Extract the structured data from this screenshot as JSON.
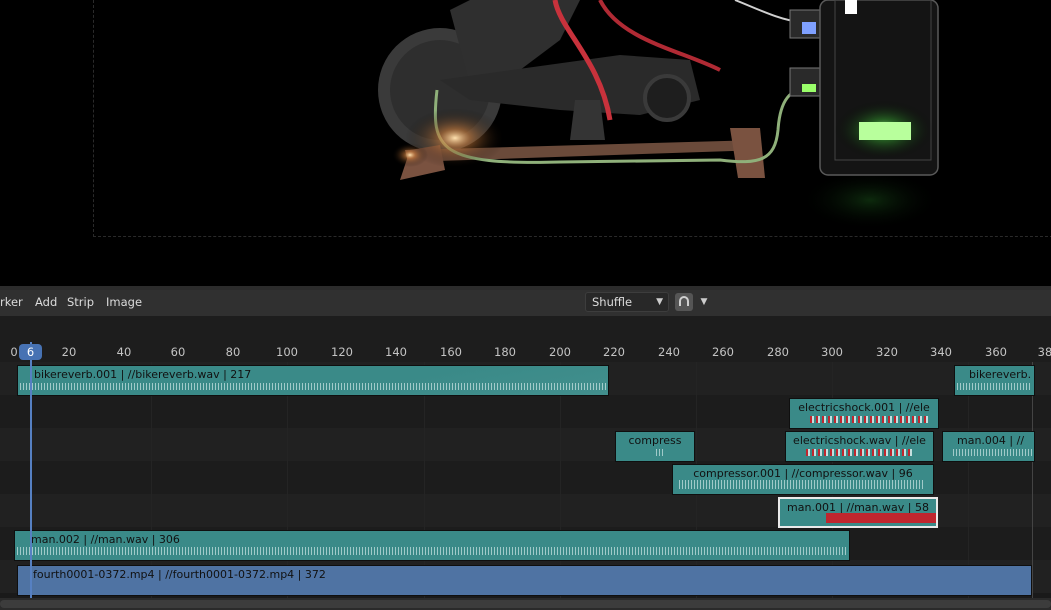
{
  "preview": {
    "scene": "bike-render"
  },
  "header": {
    "menus": [
      "rker",
      "Add",
      "Strip",
      "Image"
    ],
    "overlap_mode": "Shuffle",
    "snap_icon": "magnet-icon"
  },
  "ruler": {
    "current_frame": "6",
    "ticks": [
      "0",
      "20",
      "40",
      "60",
      "80",
      "100",
      "120",
      "140",
      "160",
      "180",
      "200",
      "220",
      "240",
      "260",
      "280",
      "300",
      "320",
      "340",
      "360",
      "38"
    ]
  },
  "strips": [
    {
      "label": "bikereverb.001 | //bikereverb.wav | 217",
      "type": "sound",
      "channel": 7
    },
    {
      "label": "bikereverb.",
      "type": "sound",
      "channel": 7
    },
    {
      "label": "electricshock.001 | //ele",
      "type": "sound",
      "channel": 6
    },
    {
      "label": "compress",
      "type": "sound",
      "channel": 5
    },
    {
      "label": "electricshock.wav | //ele",
      "type": "sound",
      "channel": 5
    },
    {
      "label": "man.004 | //",
      "type": "sound",
      "channel": 5
    },
    {
      "label": "compressor.001 | //compressor.wav | 96",
      "type": "sound",
      "channel": 4
    },
    {
      "label": "man.001 | //man.wav | 58",
      "type": "sound",
      "channel": 3,
      "selected": true
    },
    {
      "label": "man.002 | //man.wav | 306",
      "type": "sound",
      "channel": 2
    },
    {
      "label": "fourth0001-0372.mp4 | //fourth0001-0372.mp4 | 372",
      "type": "movie",
      "channel": 1
    }
  ],
  "colors": {
    "sound": "#3a8a88",
    "movie": "#4f73a3",
    "playhead": "#5680c2",
    "selected_border": "#eaeaea"
  }
}
